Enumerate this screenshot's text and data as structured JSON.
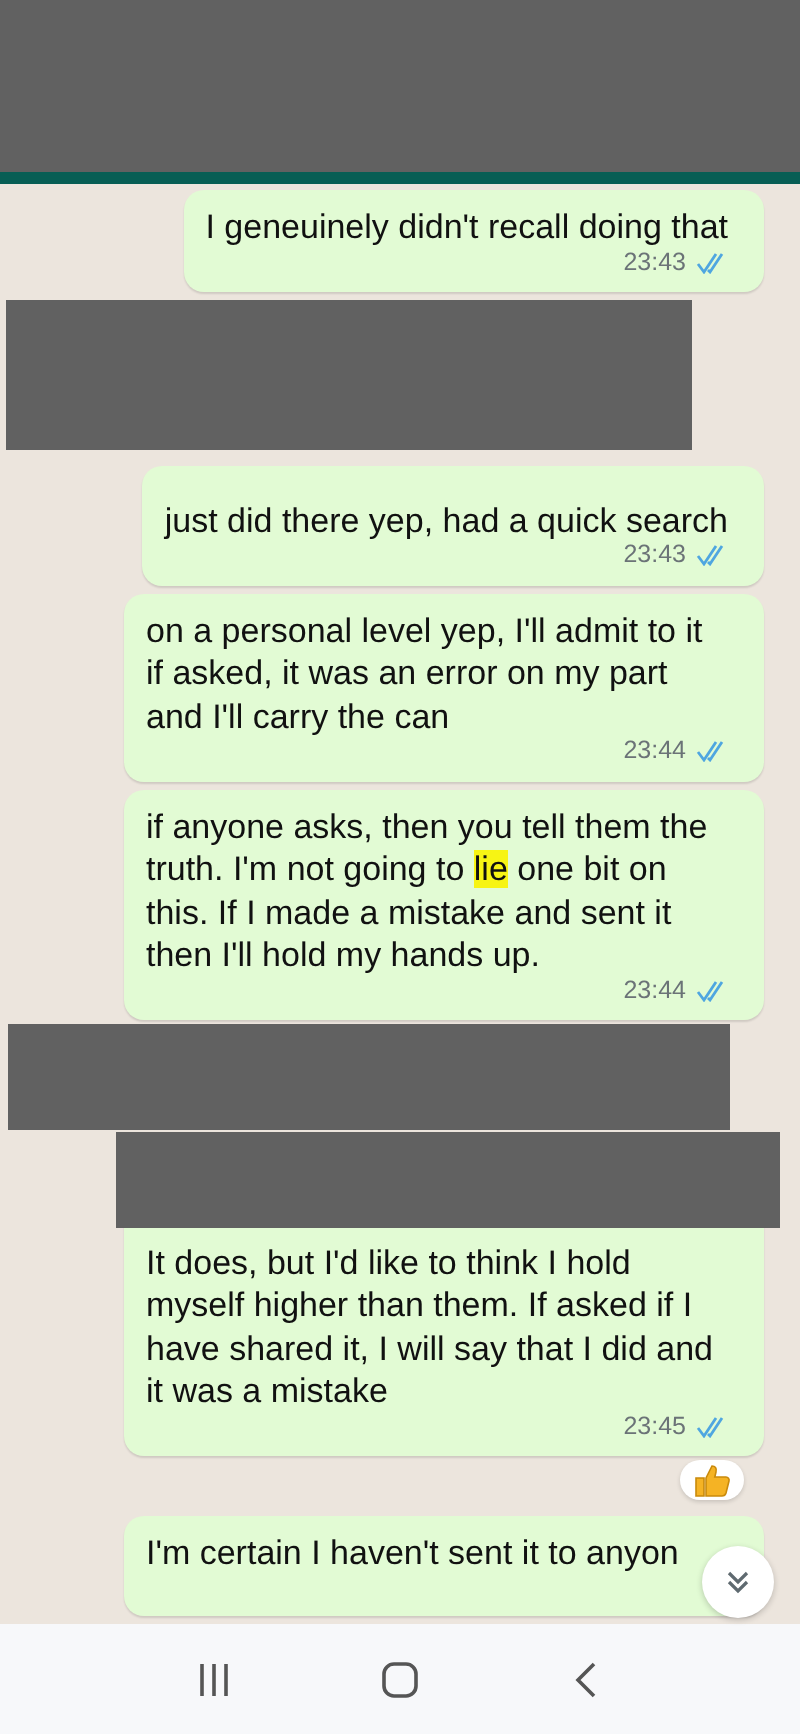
{
  "header": {
    "kind": "redacted"
  },
  "messages": [
    {
      "kind": "text",
      "segments": [
        {
          "text": "I geneuinely didn't recall doing that",
          "highlight": false
        }
      ],
      "time": "23:43",
      "read": true,
      "reacted": false
    },
    {
      "kind": "redacted"
    },
    {
      "kind": "text",
      "segments": [
        {
          "text": "just did there yep, had a quick search",
          "highlight": false
        }
      ],
      "time": "23:43",
      "read": true,
      "reacted": false
    },
    {
      "kind": "text",
      "segments": [
        {
          "text": "on a personal level yep, I'll admit to it if asked, it was an error on my part and I'll carry the can",
          "highlight": false
        }
      ],
      "time": "23:44",
      "read": true,
      "reacted": false
    },
    {
      "kind": "text",
      "segments": [
        {
          "text": "if anyone asks, then you tell them the truth. I'm not going to ",
          "highlight": false
        },
        {
          "text": "lie",
          "highlight": true
        },
        {
          "text": " one bit on this. If I made a mistake and sent it then I'll hold my hands up.",
          "highlight": false
        }
      ],
      "time": "23:44",
      "read": true,
      "reacted": false
    },
    {
      "kind": "redacted"
    },
    {
      "kind": "redacted"
    },
    {
      "kind": "text",
      "segments": [
        {
          "text": "It does, but I'd like to think I hold myself higher than them. If asked if I have shared it, I will say that I did and it was a mistake",
          "highlight": false
        }
      ],
      "time": "23:45",
      "read": true,
      "reacted": true
    },
    {
      "kind": "text",
      "segments": [
        {
          "text": "I'm certain I haven't sent it to anyon",
          "highlight": false
        }
      ],
      "reacted": false
    }
  ]
}
